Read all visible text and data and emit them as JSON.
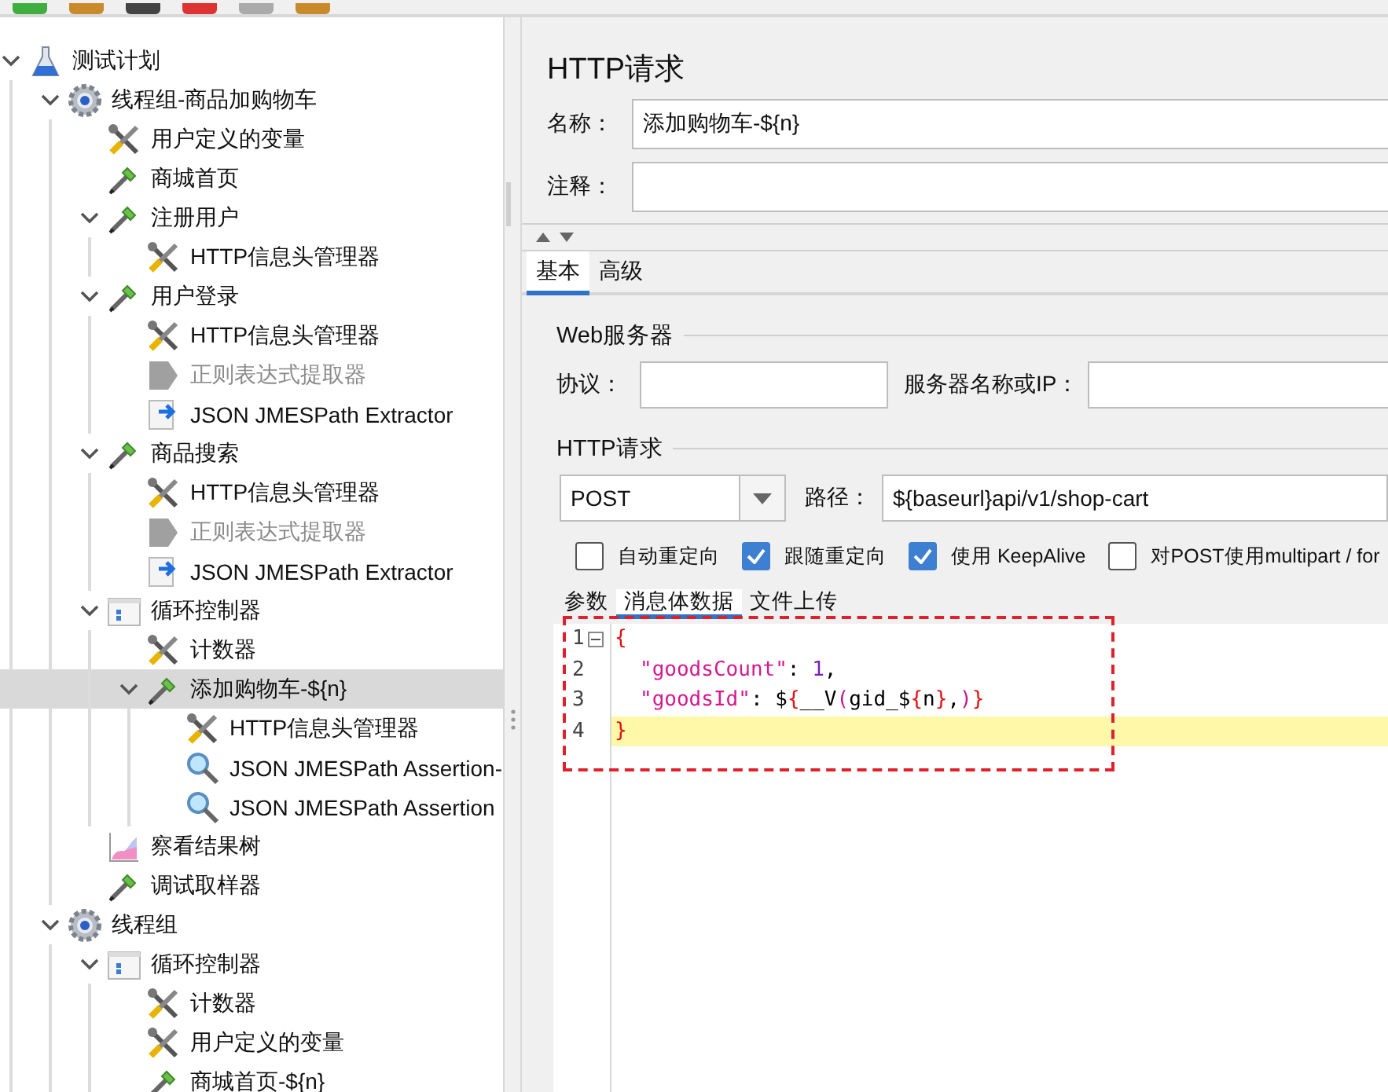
{
  "tree": [
    {
      "label": "测试计划",
      "kind": "plan",
      "selected": false,
      "disabled": false,
      "expanded": true,
      "children": [
        {
          "label": "线程组-商品加购物车",
          "kind": "thread-group",
          "selected": false,
          "disabled": false,
          "expanded": true,
          "children": [
            {
              "label": "用户定义的变量",
              "kind": "config",
              "selected": false,
              "disabled": false
            },
            {
              "label": "商城首页",
              "kind": "sampler",
              "selected": false,
              "disabled": false
            },
            {
              "label": "注册用户",
              "kind": "sampler",
              "selected": false,
              "disabled": false,
              "expanded": true,
              "children": [
                {
                  "label": "HTTP信息头管理器",
                  "kind": "config",
                  "selected": false,
                  "disabled": false
                }
              ]
            },
            {
              "label": "用户登录",
              "kind": "sampler",
              "selected": false,
              "disabled": false,
              "expanded": true,
              "children": [
                {
                  "label": "HTTP信息头管理器",
                  "kind": "config",
                  "selected": false,
                  "disabled": false
                },
                {
                  "label": "正则表达式提取器",
                  "kind": "extractor",
                  "selected": false,
                  "disabled": true
                },
                {
                  "label": "JSON JMESPath Extractor",
                  "kind": "json-extractor",
                  "selected": false,
                  "disabled": false
                }
              ]
            },
            {
              "label": "商品搜索",
              "kind": "sampler",
              "selected": false,
              "disabled": false,
              "expanded": true,
              "children": [
                {
                  "label": "HTTP信息头管理器",
                  "kind": "config",
                  "selected": false,
                  "disabled": false
                },
                {
                  "label": "正则表达式提取器",
                  "kind": "extractor",
                  "selected": false,
                  "disabled": true
                },
                {
                  "label": "JSON JMESPath Extractor",
                  "kind": "json-extractor",
                  "selected": false,
                  "disabled": false
                }
              ]
            },
            {
              "label": "循环控制器",
              "kind": "controller",
              "selected": false,
              "disabled": false,
              "expanded": true,
              "children": [
                {
                  "label": "计数器",
                  "kind": "config",
                  "selected": false,
                  "disabled": false
                },
                {
                  "label": "添加购物车-${n}",
                  "kind": "sampler",
                  "selected": true,
                  "disabled": false,
                  "expanded": true,
                  "children": [
                    {
                      "label": "HTTP信息头管理器",
                      "kind": "config",
                      "selected": false,
                      "disabled": false
                    },
                    {
                      "label": "JSON JMESPath Assertion-",
                      "kind": "assertion",
                      "selected": false,
                      "disabled": false
                    },
                    {
                      "label": "JSON JMESPath Assertion",
                      "kind": "assertion",
                      "selected": false,
                      "disabled": false
                    }
                  ]
                }
              ]
            },
            {
              "label": "察看结果树",
              "kind": "listener",
              "selected": false,
              "disabled": false
            },
            {
              "label": "调试取样器",
              "kind": "sampler",
              "selected": false,
              "disabled": false
            }
          ]
        },
        {
          "label": "线程组",
          "kind": "thread-group",
          "selected": false,
          "disabled": false,
          "expanded": true,
          "children": [
            {
              "label": "循环控制器",
              "kind": "controller",
              "selected": false,
              "disabled": false,
              "expanded": true,
              "children": [
                {
                  "label": "计数器",
                  "kind": "config",
                  "selected": false,
                  "disabled": false
                },
                {
                  "label": "用户定义的变量",
                  "kind": "config",
                  "selected": false,
                  "disabled": false
                },
                {
                  "label": "商城首页-${n}",
                  "kind": "sampler",
                  "selected": false,
                  "disabled": false
                }
              ]
            }
          ]
        }
      ]
    }
  ],
  "panel": {
    "title": "HTTP请求",
    "name": {
      "label": "名称：",
      "value": "添加购物车-${n}"
    },
    "comment": {
      "label": "注释："
    },
    "tabs": [
      {
        "label": "基本",
        "selected": true
      },
      {
        "label": "高级",
        "selected": false
      }
    ],
    "web_server": {
      "title": "Web服务器",
      "protocol_label": "协议：",
      "server_label": "服务器名称或IP："
    },
    "http_request": {
      "title": "HTTP请求",
      "method": "POST",
      "path_label": "路径：",
      "path": "${baseurl}api/v1/shop-cart"
    },
    "options": [
      {
        "label": "自动重定向",
        "checked": false
      },
      {
        "label": "跟随重定向",
        "checked": true
      },
      {
        "label": "使用 KeepAlive",
        "checked": true
      },
      {
        "label": "对POST使用multipart / for",
        "checked": false
      }
    ],
    "body_tabs": [
      {
        "label": "参数",
        "selected": false
      },
      {
        "label": "消息体数据",
        "selected": true
      },
      {
        "label": "文件上传",
        "selected": false
      }
    ],
    "code_lines": [
      {
        "number": "1",
        "highlighted": false,
        "indented": false,
        "tokens": [
          {
            "kind": "bracket",
            "text": "{"
          }
        ]
      },
      {
        "number": "2",
        "highlighted": false,
        "indented": true,
        "tokens": [
          {
            "kind": "key",
            "text": "\"goodsCount\""
          },
          {
            "kind": "plain",
            "text": ": "
          },
          {
            "kind": "number",
            "text": "1"
          },
          {
            "kind": "plain",
            "text": ","
          }
        ]
      },
      {
        "number": "3",
        "highlighted": false,
        "indented": true,
        "tokens": [
          {
            "kind": "key",
            "text": "\"goodsId\""
          },
          {
            "kind": "plain",
            "text": ": $"
          },
          {
            "kind": "bracket",
            "text": "{"
          },
          {
            "kind": "plain",
            "text": "__V"
          },
          {
            "kind": "paren",
            "text": "("
          },
          {
            "kind": "plain",
            "text": "gid_$"
          },
          {
            "kind": "bracket",
            "text": "{"
          },
          {
            "kind": "plain",
            "text": "n"
          },
          {
            "kind": "bracket",
            "text": "}"
          },
          {
            "kind": "plain",
            "text": ","
          },
          {
            "kind": "paren",
            "text": ")"
          },
          {
            "kind": "bracket",
            "text": "}"
          }
        ]
      },
      {
        "number": "4",
        "highlighted": true,
        "indented": false,
        "tokens": [
          {
            "kind": "bracket",
            "text": "}"
          }
        ]
      }
    ]
  }
}
